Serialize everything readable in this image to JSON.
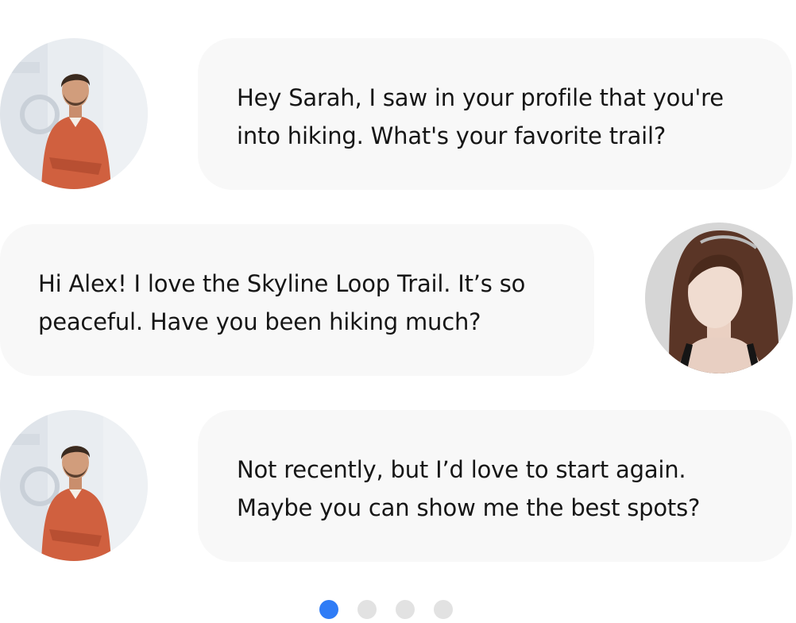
{
  "messages": [
    {
      "sender": "Alex",
      "text": "Hey Sarah, I saw in your profile that you're into hiking. What's your favorite trail?"
    },
    {
      "sender": "Sarah",
      "text": "Hi Alex! I love the Skyline Loop Trail. It’s so peaceful. Have you been hiking much?"
    },
    {
      "sender": "Alex",
      "text": "Not recently, but I’d love to start again. Maybe you can show me the best spots?"
    }
  ],
  "pagination": {
    "total": 4,
    "active_index": 0,
    "active_color": "#2f7cf6",
    "inactive_color": "#e2e2e2"
  },
  "colors": {
    "bubble": "#f8f8f8",
    "text": "#161616"
  }
}
